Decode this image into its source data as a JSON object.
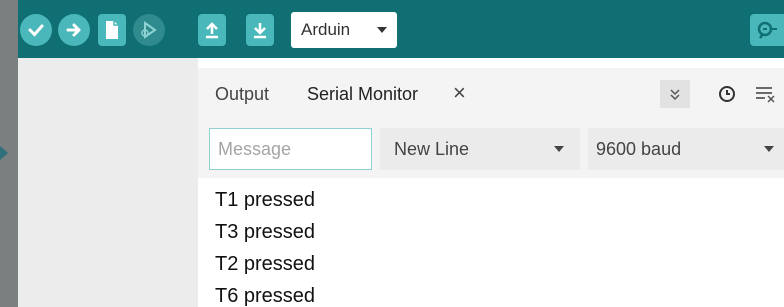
{
  "toolbar": {
    "buttons": [
      {
        "name": "verify-button",
        "icon": "checkmark-icon"
      },
      {
        "name": "upload-button",
        "icon": "arrow-right-icon"
      },
      {
        "name": "new-sketch-button",
        "icon": "document-icon"
      },
      {
        "name": "debug-button",
        "icon": "debug-icon"
      },
      {
        "name": "open-button",
        "icon": "upload-arrow-icon"
      },
      {
        "name": "save-button",
        "icon": "download-arrow-icon"
      }
    ],
    "board_select": {
      "value": "Arduin"
    },
    "serial_monitor_button": {
      "icon": "magnifier-icon"
    }
  },
  "bottom_panel": {
    "tabs": [
      {
        "label": "Output",
        "active": false
      },
      {
        "label": "Serial Monitor",
        "active": true
      }
    ],
    "close_symbol": "×",
    "tools": [
      "autoscroll-icon",
      "timestamp-icon",
      "clear-output-icon"
    ]
  },
  "serial": {
    "message_placeholder": "Message",
    "line_ending": "New Line",
    "baud_rate": "9600 baud"
  },
  "output_lines": [
    "T1 pressed",
    "T3 pressed",
    "T2 pressed",
    "T6 pressed"
  ],
  "colors": {
    "toolbar_bg": "#0f6f72",
    "button_bg": "#4ab8ba",
    "input_border": "#8fd0d3"
  }
}
